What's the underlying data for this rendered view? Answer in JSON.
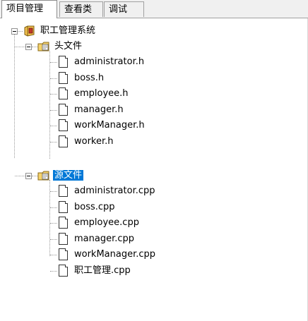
{
  "tabs": [
    {
      "label": "项目管理",
      "active": true
    },
    {
      "label": "查看类",
      "active": false
    },
    {
      "label": "调试",
      "active": false
    }
  ],
  "tree": {
    "project": {
      "label": "职工管理系统",
      "icon": "project-icon",
      "expanded": true
    },
    "headers": {
      "label": "头文件",
      "icon": "folder-icon",
      "expanded": true,
      "files": [
        "administrator.h",
        "boss.h",
        "employee.h",
        "manager.h",
        "workManager.h",
        "worker.h"
      ]
    },
    "sources": {
      "label": "源文件",
      "icon": "folder-icon",
      "expanded": true,
      "selected": true,
      "files": [
        "administrator.cpp",
        "boss.cpp",
        "employee.cpp",
        "manager.cpp",
        "workManager.cpp",
        "职工管理.cpp"
      ]
    }
  },
  "colors": {
    "selection": "#0078d7",
    "tab_border": "#a0a0a0",
    "tree_lines": "#9a9a9a"
  }
}
